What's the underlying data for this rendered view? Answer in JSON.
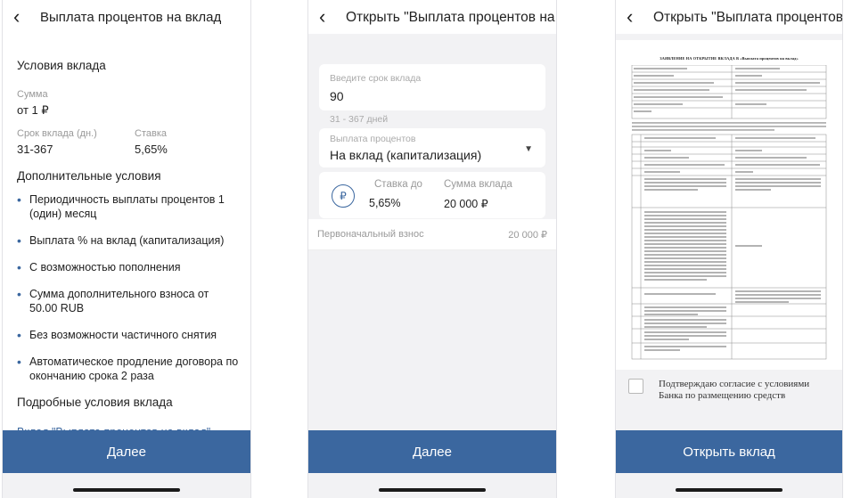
{
  "screen1": {
    "title": "Выплата процентов на вклад",
    "section1_title": "Условия вклада",
    "amount_label": "Сумма",
    "amount_value": "от 1 ₽",
    "term_label": "Срок вклада (дн.)",
    "term_value": "31-367",
    "rate_label": "Ставка",
    "rate_value": "5,65%",
    "section2_title": "Дополнительные условия",
    "bullets": [
      "Периодичность выплаты процентов 1 (один) месяц",
      "Выплата % на вклад (капитализация)",
      "С возможностью пополнения",
      "Сумма дополнительного взноса от 50.00 RUB",
      "Без возможности частичного снятия",
      "Автоматическое продление договора по окончанию срока 2 раза"
    ],
    "section3_title": "Подробные условия вклада",
    "details_link": "Вклад \"Выплата процентов на вклад\"",
    "next_button": "Далее"
  },
  "screen2": {
    "title": "Открыть \"Выплата процентов на вк...",
    "term_placeholder": "Введите срок вклада",
    "term_value": "90",
    "term_hint": "31 - 367 дней",
    "payout_label": "Выплата процентов",
    "payout_value": "На вклад (капитализация)",
    "rate_label": "Ставка до",
    "rate_value": "5,65%",
    "sum_label": "Сумма вклада",
    "sum_value": "20 000 ₽",
    "initial_label": "Первоначальный взнос",
    "initial_value": "20 000 ₽",
    "next_button": "Далее"
  },
  "screen3": {
    "title": "Открыть \"Выплата процентов на вк...",
    "document_title": "ЗАЯВЛЕНИЕ НА ОТКРЫТИЕ ВКЛАДА В «Выплата процентов на вклад»",
    "confirm_text": "Подтверждаю согласие с условиями Банка по размещению средств",
    "open_button": "Открыть вклад"
  },
  "colors": {
    "accent": "#3b679f",
    "background": "#f2f2f4"
  },
  "icons": {
    "back": "chevron-left-icon",
    "dropdown": "caret-down-icon",
    "currency": "ruble-icon"
  }
}
